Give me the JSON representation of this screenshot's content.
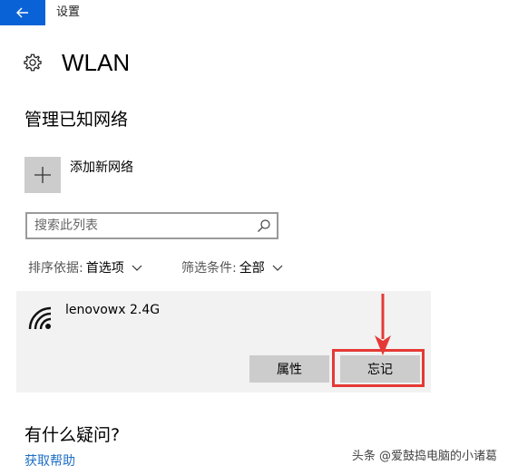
{
  "window": {
    "title": "设置",
    "back_icon": "arrow-left-icon",
    "accent_color": "#0a63d6"
  },
  "header": {
    "icon": "gear-icon",
    "title": "WLAN"
  },
  "manage": {
    "title": "管理已知网络",
    "add_network_label": "添加新网络",
    "search": {
      "placeholder": "搜索此列表",
      "value": ""
    },
    "sort": {
      "label": "排序依据:",
      "value": "首选项"
    },
    "filter": {
      "label": "筛选条件:",
      "value": "全部"
    },
    "networks": [
      {
        "name": "lenovowx 2.4G",
        "icon": "wifi-icon",
        "buttons": {
          "properties": "属性",
          "forget": "忘记"
        }
      }
    ]
  },
  "annotation": {
    "highlight_color": "#e53935"
  },
  "help": {
    "title": "有什么疑问?",
    "link": "获取帮助",
    "link_color": "#1f6fc5"
  },
  "watermark": "头条 @爱鼓捣电脑的小诸葛"
}
